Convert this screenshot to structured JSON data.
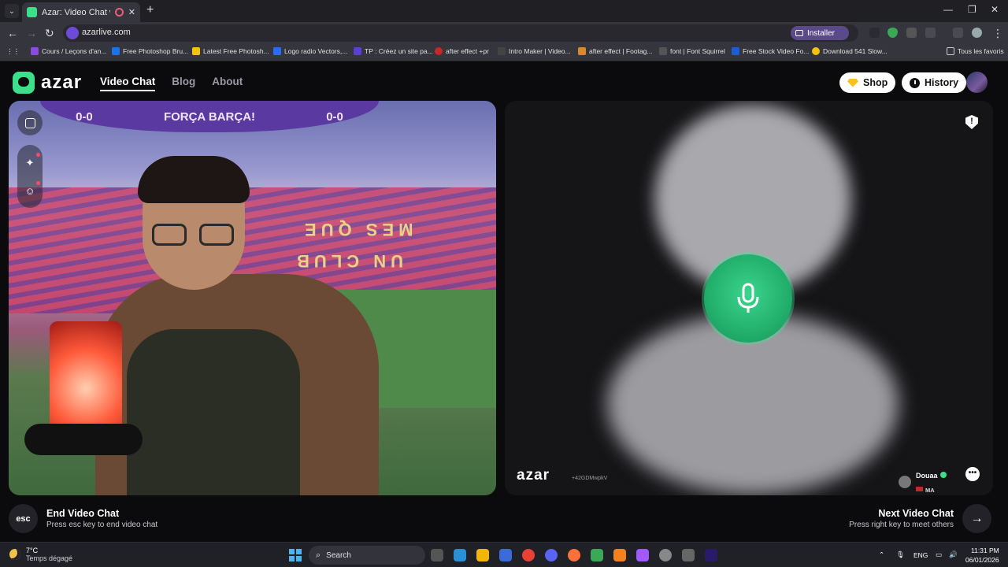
{
  "browser": {
    "tab_title": "Azar: Video Chat with New",
    "tab_close": "✕",
    "new_tab": "+",
    "url": "azarlive.com",
    "install_label": "Installer",
    "bookmarks": [
      {
        "label": "Cours / Leçons d'an...",
        "color": "#8a4be0"
      },
      {
        "label": "Free Photoshop Bru...",
        "color": "#1a73e8"
      },
      {
        "label": "Latest Free Photosh...",
        "color": "#f4c20d"
      },
      {
        "label": "Logo radio Vectors,...",
        "color": "#2a6df4"
      },
      {
        "label": "TP : Créez un site pa...",
        "color": "#5b3fd6"
      },
      {
        "label": "after effect +pr",
        "color": "#c62828"
      },
      {
        "label": "Intro Maker | Video...",
        "color": "#444"
      },
      {
        "label": "after effect | Footag...",
        "color": "#d68a2a"
      },
      {
        "label": "font | Font Squirrel",
        "color": "#555"
      },
      {
        "label": "Free Stock Video Fo...",
        "color": "#1e5bd6"
      },
      {
        "label": "Download 541 Slow...",
        "color": "#f4c20d"
      }
    ],
    "all_bookmarks": "Tous les favoris"
  },
  "header": {
    "logo_text": "azar",
    "nav": [
      {
        "label": "Video Chat",
        "active": true
      },
      {
        "label": "Blog",
        "active": false
      },
      {
        "label": "About",
        "active": false
      }
    ],
    "shop_label": "Shop",
    "history_label": "History"
  },
  "local_video": {
    "banner_left_score": "0-0",
    "banner_text": "FORÇA BARÇA!",
    "banner_right_score": "0-0",
    "stand_text_top": "MES QUE",
    "stand_text_bottom": "UN CLUB"
  },
  "remote_video": {
    "watermark": "azar",
    "watermark_id": "+42GDMwpkV",
    "partner_name": "Douaa",
    "partner_country": "MA",
    "report_icon": "!",
    "chat_icon": "•••"
  },
  "footer": {
    "esc_key": "esc",
    "end_title": "End Video Chat",
    "end_sub": "Press esc key to end video chat",
    "next_title": "Next Video Chat",
    "next_sub": "Press right key to meet others",
    "next_arrow": "→"
  },
  "taskbar": {
    "temp": "7°C",
    "weather": "Temps dégagé",
    "search_label": "Search",
    "lang": "ENG",
    "time": "11:31 PM",
    "date": "06/01/2026"
  },
  "colors": {
    "accent": "#3ce08a",
    "mic_green": "#1fa867",
    "page_bg": "#0b0b0e"
  }
}
